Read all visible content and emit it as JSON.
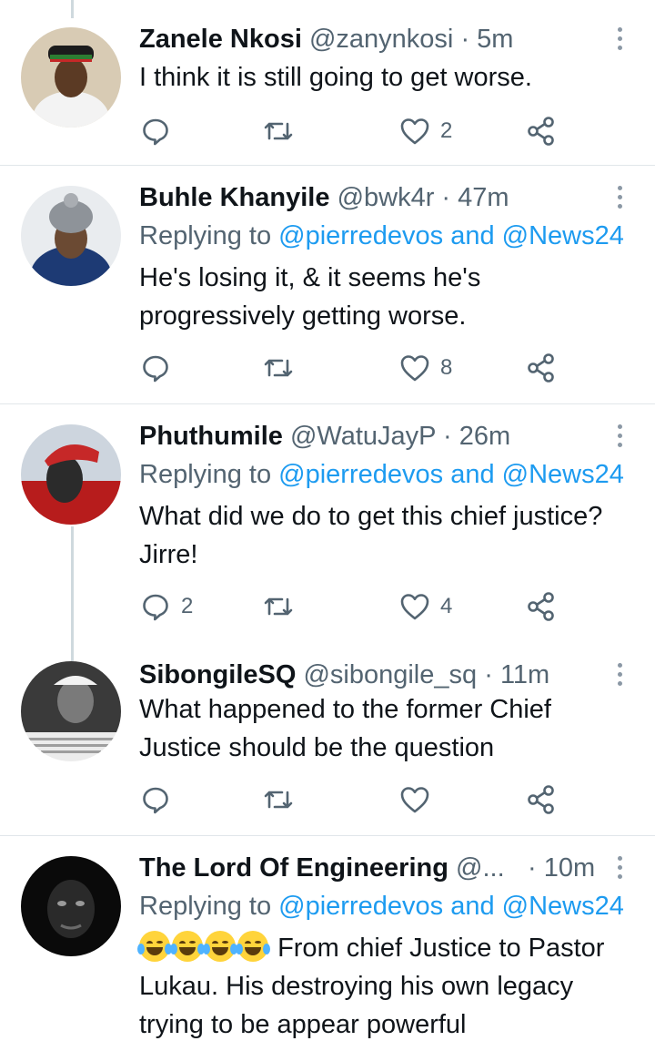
{
  "icons": {
    "reply": "reply-icon",
    "retweet": "retweet-icon",
    "like": "heart-icon",
    "share": "share-icon",
    "more": "more-icon"
  },
  "colors": {
    "mention": "#1d9bf0",
    "secondary_text": "#536471",
    "divider": "#e1e6ea",
    "thread_line": "#cfd9de"
  },
  "tweets": [
    {
      "name": "Zanele Nkosi",
      "handle": "@zanynkosi",
      "dot": "·",
      "time": "5m",
      "text": "I think it is still going to get worse.",
      "reply_count": "",
      "retweet_count": "",
      "like_count": "2"
    },
    {
      "name": "Buhle Khanyile",
      "handle": "@bwk4r",
      "dot": "·",
      "time": "47m",
      "replying_prefix": "Replying to",
      "replying_user1": "@pierredevos",
      "replying_and": "and",
      "replying_user2": "@News24",
      "text_line1": "He's losing it, & it seems he's",
      "text_line2": "progressively getting worse.",
      "reply_count": "",
      "retweet_count": "",
      "like_count": "8"
    },
    {
      "name": "Phuthumile",
      "handle": "@WatuJayP",
      "dot": "·",
      "time": "26m",
      "replying_prefix": "Replying to",
      "replying_user1": "@pierredevos",
      "replying_and": "and",
      "replying_user2": "@News24",
      "text_line1": "What did we do to get this chief justice?",
      "text_line2": "Jirre!",
      "reply_count": "2",
      "retweet_count": "",
      "like_count": "4"
    },
    {
      "name": "SibongileSQ",
      "handle": "@sibongile_sq",
      "dot": "·",
      "time": "11m",
      "text_line1": "What happened to the former Chief",
      "text_line2": "Justice should be the question",
      "reply_count": "",
      "retweet_count": "",
      "like_count": ""
    },
    {
      "name": "The Lord Of Engineering",
      "handle": "@...",
      "dot": "·",
      "time": "10m",
      "replying_prefix": "Replying to",
      "replying_user1": "@pierredevos",
      "replying_and": "and",
      "replying_user2": "@News24",
      "text_line1": "From chief Justice to Pastor",
      "text_line2": "Lukau. His destroying his own legacy",
      "text_line3": "trying to be appear powerful"
    }
  ]
}
